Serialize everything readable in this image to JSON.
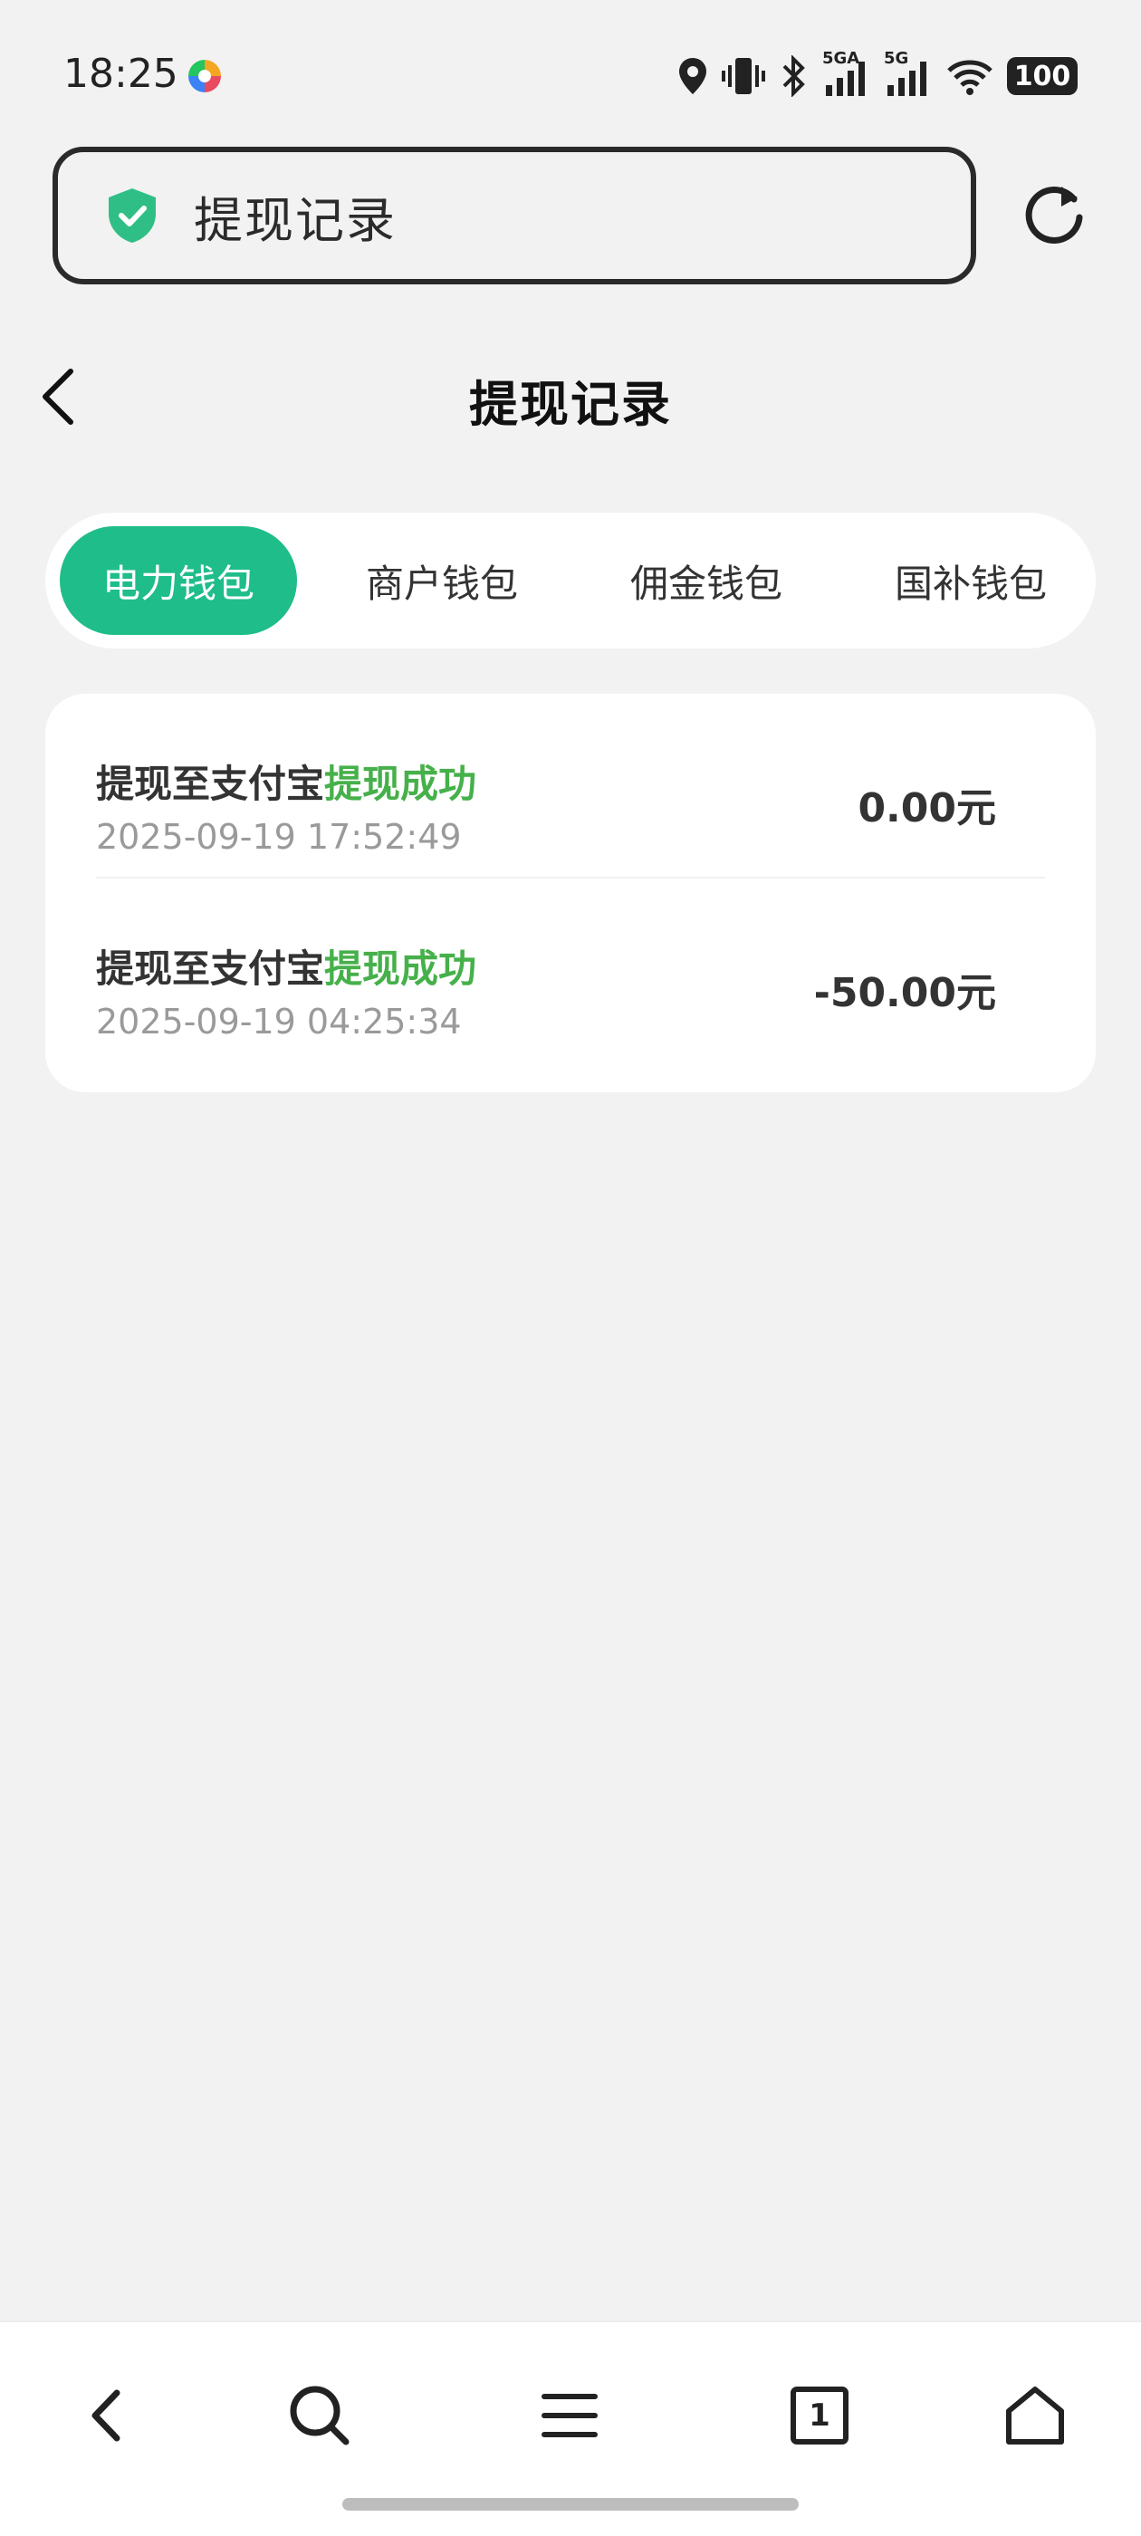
{
  "status_bar": {
    "time": "18:25",
    "network_1": "5GA",
    "network_2": "5G",
    "battery": "100"
  },
  "browser": {
    "url_text": "提现记录",
    "tab_count": "1"
  },
  "page": {
    "title": "提现记录"
  },
  "tabs": [
    {
      "label": "电力钱包",
      "active": true
    },
    {
      "label": "商户钱包",
      "active": false
    },
    {
      "label": "佣金钱包",
      "active": false
    },
    {
      "label": "国补钱包",
      "active": false
    }
  ],
  "records": [
    {
      "title": "提现至支付宝",
      "status": "提现成功",
      "time": "2025-09-19 17:52:49",
      "amount": "0.00元"
    },
    {
      "title": "提现至支付宝",
      "status": "提现成功",
      "time": "2025-09-19 04:25:34",
      "amount": "-50.00元"
    }
  ],
  "colors": {
    "accent": "#1fbd8a",
    "success_text": "#46b04a",
    "background": "#f2f2f2"
  }
}
